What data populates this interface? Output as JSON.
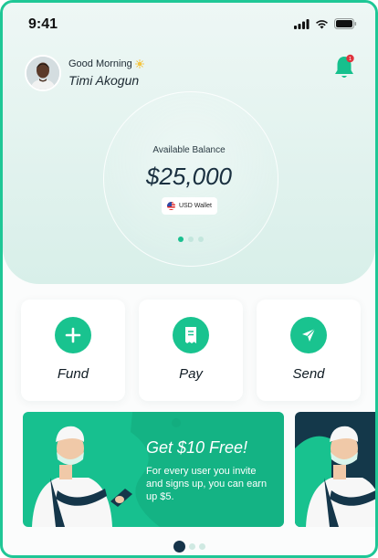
{
  "status_bar": {
    "time": "9:41"
  },
  "header": {
    "greeting": "Good Morning",
    "greeting_icon": "sun-icon",
    "user_name": "Timi Akogun",
    "notification_badge": "1"
  },
  "balance": {
    "label": "Available Balance",
    "amount": "$25,000",
    "wallet": "USD Wallet",
    "carousel_pages": 3,
    "carousel_active": 0
  },
  "actions": [
    {
      "label": "Fund",
      "icon": "plus-icon"
    },
    {
      "label": "Pay",
      "icon": "receipt-icon"
    },
    {
      "label": "Send",
      "icon": "send-icon"
    }
  ],
  "promo": {
    "title": "Get $10 Free!",
    "text": "For every user you invite and signs up, you can earn up $5."
  },
  "promo_carousel": {
    "pages": 3,
    "active": 0
  },
  "colors": {
    "accent": "#19c38f",
    "dark": "#14384a",
    "frame": "#1fc796"
  }
}
